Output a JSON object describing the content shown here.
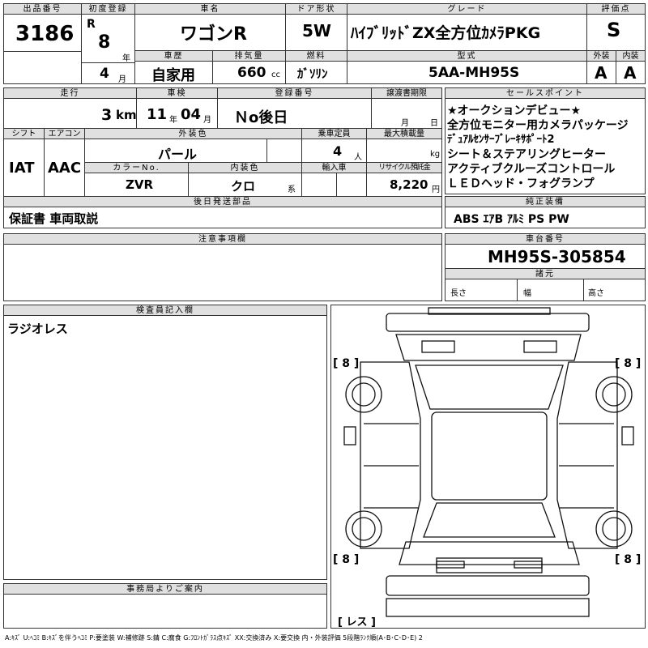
{
  "header": {
    "lot_label": "出品番号",
    "lot_no": "3186",
    "first_reg_label": "初度登録",
    "era": "R",
    "year": "8",
    "year_unit": "年",
    "month": "4",
    "month_unit": "月",
    "name_label": "車名",
    "car_name": "ワゴンR",
    "door_label": "ドア形状",
    "door": "5W",
    "grade_label": "グレード",
    "grade": "ﾊｲﾌﾞﾘｯﾄﾞZX全方位ｶﾒﾗPKG",
    "score_label": "評価点",
    "score": "S",
    "history_label": "車歴",
    "history": "自家用",
    "cc_label": "排気量",
    "cc": "660",
    "cc_unit": "cc",
    "fuel_label": "燃料",
    "fuel": "ｶﾞｿﾘﾝ",
    "model_label": "型式",
    "model": "5AA-MH95S",
    "ext_label": "外装",
    "ext_grade": "A",
    "int_label": "内装",
    "int_grade": "A"
  },
  "row2": {
    "mileage_label": "走行",
    "mileage": "3",
    "mileage_unit": "km",
    "inspection_label": "車検",
    "insp_year": "11",
    "insp_year_unit": "年",
    "insp_month": "04",
    "insp_month_unit": "月",
    "reg_label": "登録番号",
    "reg_no": "Ｎo後日",
    "transfer_label": "譲渡書期限",
    "transfer_month_unit": "月",
    "transfer_day_unit": "日",
    "shift_label": "シフト",
    "shift": "IAT",
    "ac_label": "エアコン",
    "ac": "AAC",
    "color_label": "外装色",
    "color": "パール",
    "capacity_label": "乗車定員",
    "capacity": "4",
    "capacity_unit": "人",
    "load_label": "最大積載量",
    "load_unit": "kg",
    "color_no_label": "カラーNo.",
    "color_no": "ZVR",
    "int_color_label": "内装色",
    "int_color": "クロ",
    "int_color_unit": "系",
    "import_label": "輸入車",
    "recycle_label": "リサイクル預託金",
    "recycle": "8,220",
    "recycle_unit": "円",
    "later_label": "後日発送部品",
    "later": "保証書 車両取説"
  },
  "sales_points": {
    "label": "セールスポイント",
    "items": [
      "★オークションデビュー★",
      "全方位モニター用カメラパッケージ",
      "ﾃﾞｭｱﾙｾﾝｻｰﾌﾞﾚｰｷｻﾎﾟｰﾄ2",
      "シート＆ステアリングヒーター",
      "アクティブクルーズコントロール",
      "ＬＥＤヘッド・フォグランプ"
    ]
  },
  "equipment": {
    "label": "純正装備",
    "value": "ABS ｴｱB ｱﾙﾐ PS PW"
  },
  "notes": {
    "label": "注意事項欄"
  },
  "chassis": {
    "label": "車台番号",
    "value": "MH95S-305854",
    "spec_label": "諸元",
    "length": "長さ",
    "width": "幅",
    "height": "高さ"
  },
  "inspector": {
    "label": "検査員記入欄",
    "value": "ラジオレス"
  },
  "office": {
    "label": "事務局よりご案内"
  },
  "diagram": {
    "tire_fl": "[ 8 ]",
    "tire_fr": "[ 8 ]",
    "tire_rl": "[ 8 ]",
    "tire_rr": "[ 8 ]",
    "note": "[ レス ]"
  },
  "legend": "A:ｷｽﾞ U:ﾍｺﾐ B:ｷｽﾞを伴うﾍｺﾐ P:要塗装 W:補修跡 S:錆 C:腐食 G:ﾌﾛﾝﾄｶﾞﾗｽ点ｷｽﾞ XX:交換済み X:要交換 内・外装評価 5段階ﾗﾝｸ順(A･B･C･D･E) 2"
}
